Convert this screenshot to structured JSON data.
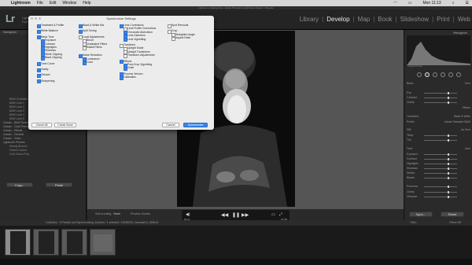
{
  "menubar": {
    "app": "Lightroom",
    "items": [
      "File",
      "Edit",
      "Window",
      "Help"
    ],
    "clock": "Mon 11:13"
  },
  "window_title": "Lightroom Catalog.lrcat - Adobe Photoshop Lightroom Classic - Develop",
  "identity": {
    "logo": "Lr",
    "line1": "Lightroom Classic",
    "line2": "Port View"
  },
  "modules": [
    "Library",
    "Develop",
    "Map",
    "Book",
    "Slideshow",
    "Print",
    "Web"
  ],
  "active_module": "Develop",
  "left_panel": {
    "navigator": "Navigator",
    "presets": [
      {
        "label": "B&W Contrast Low",
        "sub": true
      },
      {
        "label": "B&W Look 1",
        "sub": true
      },
      {
        "label": "B&W Look 2",
        "sub": true
      },
      {
        "label": "B&W Look 3",
        "sub": true
      },
      {
        "label": "B&W Look 4",
        "sub": true
      },
      {
        "label": "B&W Look 5",
        "sub": true
      },
      {
        "label": "Classic - B&W Toned",
        "sub": false
      },
      {
        "label": "Classic - Color Presets",
        "sub": false
      },
      {
        "label": "Classic - Effects",
        "sub": false
      },
      {
        "label": "Classic - General",
        "sub": false
      },
      {
        "label": "Classic - Video",
        "sub": false
      },
      {
        "label": "Lightroom Presets",
        "sub": false
      },
      {
        "label": "Moody Browns",
        "sub": true
      },
      {
        "label": "Faded Colours",
        "sub": true
      },
      {
        "label": "Cool Colour Pop",
        "sub": true
      }
    ],
    "copy_btn": "Copy...",
    "paste_btn": "Paste"
  },
  "dialog": {
    "title": "Synchronize Settings",
    "col1": [
      {
        "label": "Treatment & Profile",
        "on": true,
        "indent": false
      },
      {
        "label": "",
        "gap": true
      },
      {
        "label": "White Balance",
        "on": true,
        "indent": false
      },
      {
        "label": "",
        "gap": true
      },
      {
        "label": "Basic Tone",
        "on": true,
        "indent": false
      },
      {
        "label": "Exposure",
        "on": true,
        "indent": true
      },
      {
        "label": "Contrast",
        "on": true,
        "indent": true
      },
      {
        "label": "Highlights",
        "on": true,
        "indent": true
      },
      {
        "label": "Shadows",
        "on": true,
        "indent": true
      },
      {
        "label": "White Clipping",
        "on": true,
        "indent": true
      },
      {
        "label": "Black Clipping",
        "on": true,
        "indent": true
      },
      {
        "label": "",
        "gap": true
      },
      {
        "label": "Tone Curve",
        "on": true,
        "indent": false
      },
      {
        "label": "",
        "gap": true
      },
      {
        "label": "Clarity",
        "on": true,
        "indent": false
      },
      {
        "label": "",
        "gap": true
      },
      {
        "label": "Dehaze",
        "on": true,
        "indent": false
      },
      {
        "label": "",
        "gap": true
      },
      {
        "label": "Sharpening",
        "on": true,
        "indent": false
      }
    ],
    "col2": [
      {
        "label": "Black & White Mix",
        "on": true,
        "indent": false
      },
      {
        "label": "",
        "gap": true
      },
      {
        "label": "Split Toning",
        "on": true,
        "indent": false
      },
      {
        "label": "",
        "gap": true
      },
      {
        "label": "Local Adjustments",
        "on": false,
        "indent": false
      },
      {
        "label": "Brush",
        "on": false,
        "indent": true
      },
      {
        "label": "Graduated Filters",
        "on": false,
        "indent": true
      },
      {
        "label": "Radial Filters",
        "on": false,
        "indent": true
      },
      {
        "label": "",
        "gap": true
      },
      {
        "label": "",
        "gap": true
      },
      {
        "label": "Noise Reduction",
        "on": true,
        "indent": false
      },
      {
        "label": "Luminance",
        "on": true,
        "indent": true
      },
      {
        "label": "Color",
        "on": true,
        "indent": true
      }
    ],
    "col3": [
      {
        "label": "Lens Corrections",
        "on": true,
        "indent": false
      },
      {
        "label": "Lens Profile Corrections",
        "on": false,
        "indent": true
      },
      {
        "label": "Chromatic Aberration",
        "on": true,
        "indent": true
      },
      {
        "label": "Lens Distortion",
        "on": true,
        "indent": true
      },
      {
        "label": "Lens Vignetting",
        "on": true,
        "indent": true
      },
      {
        "label": "",
        "gap": true
      },
      {
        "label": "Transform",
        "on": false,
        "indent": false
      },
      {
        "label": "Upright Mode",
        "on": false,
        "indent": true
      },
      {
        "label": "Upright Transforms",
        "on": false,
        "indent": true
      },
      {
        "label": "Transform Adjustments",
        "on": false,
        "indent": true
      },
      {
        "label": "",
        "gap": true
      },
      {
        "label": "Effects",
        "on": true,
        "indent": false
      },
      {
        "label": "Post-Crop Vignetting",
        "on": true,
        "indent": true
      },
      {
        "label": "Grain",
        "on": true,
        "indent": true
      },
      {
        "label": "",
        "gap": true
      },
      {
        "label": "Process Version",
        "on": true,
        "indent": false
      },
      {
        "label": "Calibration",
        "on": true,
        "indent": false
      }
    ],
    "col4": [
      {
        "label": "Spot Removal",
        "on": false,
        "indent": false
      },
      {
        "label": "",
        "gap": true
      },
      {
        "label": "Crop",
        "on": false,
        "indent": false
      },
      {
        "label": "Straighten Angle",
        "on": false,
        "indent": true
      },
      {
        "label": "Aspect Ratio",
        "on": false,
        "indent": true
      }
    ],
    "check_all": "Check All",
    "check_none": "Check None",
    "cancel": "Cancel",
    "synchronize": "Synchronize"
  },
  "right_panel": {
    "histogram": "Histogram",
    "original_photo": "Original Photo",
    "rows": [
      {
        "l": "Basic",
        "r": "Tone"
      },
      {
        "l": "Exp",
        "r": ""
      },
      {
        "l": "Contrast",
        "r": ""
      },
      {
        "l": "Clarity",
        "r": ""
      },
      {
        "l": "",
        "r": "Effects"
      },
      {
        "l": "Treatment",
        "r": "Black & White"
      },
      {
        "l": "Profile",
        "r": "Adobe Standard B&W"
      },
      {
        "l": "WB",
        "r": "As Shot"
      },
      {
        "l": "Temp",
        "r": ""
      },
      {
        "l": "Tint",
        "r": ""
      },
      {
        "l": "Tone",
        "r": "Auto"
      },
      {
        "l": "Exposure",
        "r": ""
      },
      {
        "l": "Contrast",
        "r": ""
      },
      {
        "l": "Highlights",
        "r": ""
      },
      {
        "l": "Shadows",
        "r": ""
      },
      {
        "l": "Whites",
        "r": ""
      },
      {
        "l": "Blacks",
        "r": ""
      },
      {
        "l": "Presence",
        "r": ""
      },
      {
        "l": "Clarity",
        "r": ""
      },
      {
        "l": "Vibrance",
        "r": ""
      }
    ],
    "sync_btn": "Sync...",
    "reset_btn": "Reset"
  },
  "toolbar": {
    "soft_proofing_label": "Soft proofing",
    "soft_proofing_value": "None",
    "preview_label": "Preview Guides"
  },
  "video": {
    "elapsed": "00:11",
    "remaining": "-51:58"
  },
  "filmstrip_header": {
    "text": "Collection : 3 Presets and Synchronizing   4 photos / 1 selected / 20180223_Varanasi10_8265.tif",
    "filter_label": "Filter:",
    "filters_off": "Filters Off"
  }
}
